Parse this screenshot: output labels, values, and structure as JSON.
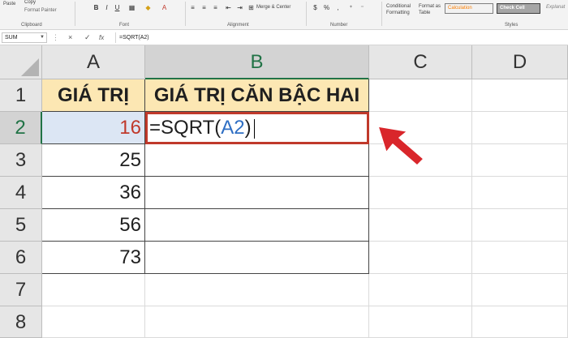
{
  "ribbon": {
    "clipboard": {
      "paste_label": "Paste",
      "copy_label": "Copy",
      "format_painter_label": "Format Painter",
      "group_title": "Clipboard"
    },
    "font": {
      "bold_label": "B",
      "italic_label": "I",
      "underline_label": "U",
      "font_color_label": "A",
      "group_title": "Font"
    },
    "alignment": {
      "merge_center_label": "Merge & Center",
      "group_title": "Alignment"
    },
    "number": {
      "currency_label": "$",
      "percent_label": "%",
      "comma_label": ",",
      "group_title": "Number"
    },
    "styles": {
      "conditional_formatting_label": "Conditional Formatting",
      "format_as_table_label": "Format as Table",
      "calculation_label": "Calculation",
      "check_cell_label": "Check Cell",
      "explanatory_label": "Explanat",
      "group_title": "Styles"
    }
  },
  "formula_bar": {
    "name_box": "SUM",
    "cancel_icon": "×",
    "enter_icon": "✓",
    "function_icon": "fx",
    "formula": "=SQRT(A2)"
  },
  "columns": [
    "A",
    "B",
    "C",
    "D"
  ],
  "rows": [
    "1",
    "2",
    "3",
    "4",
    "5",
    "6",
    "7",
    "8"
  ],
  "cells": {
    "A1": "GIÁ TRỊ",
    "B1": "GIÁ TRỊ CĂN BẬC HAI",
    "A2": "16",
    "A3": "25",
    "A4": "36",
    "A5": "56",
    "A6": "73"
  },
  "edit": {
    "prefix": "=SQRT(",
    "ref": "A2",
    "suffix": ")"
  },
  "colors": {
    "header_fill": "#fce7b3",
    "reference_fill": "#dce6f4",
    "reference_text": "#2f6fc4",
    "value_text_red": "#c0392b",
    "edit_border": "#c0392b",
    "arrow": "#d9262b",
    "excel_green": "#217346"
  }
}
